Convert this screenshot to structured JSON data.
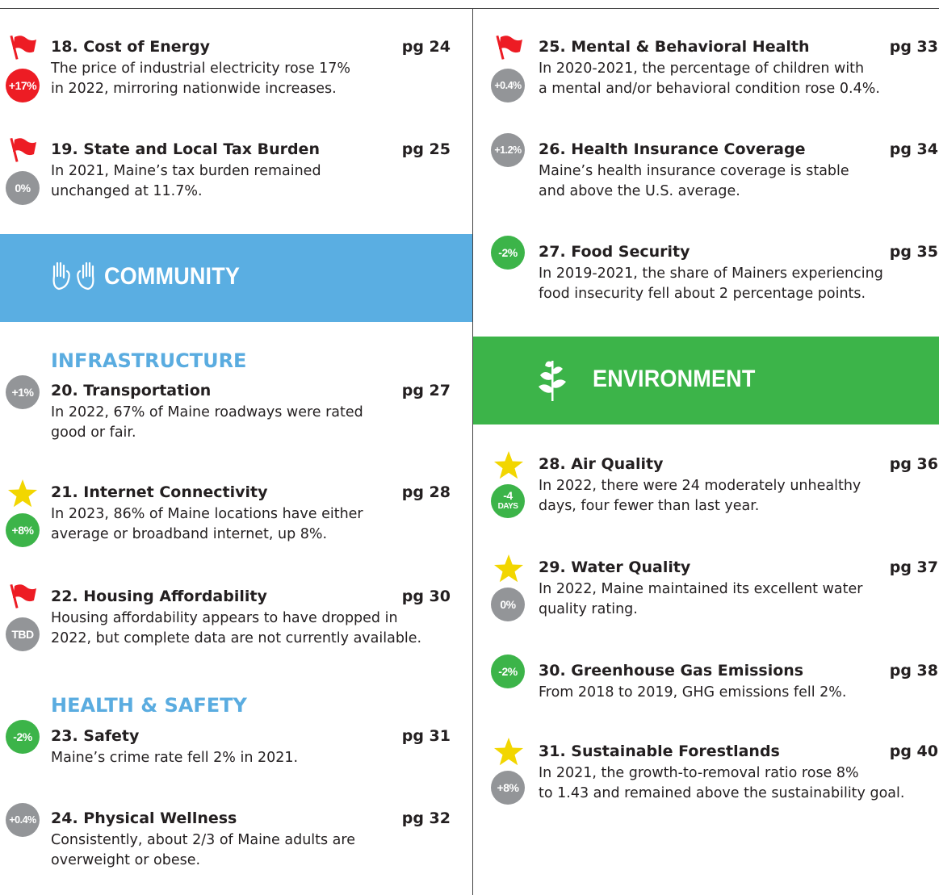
{
  "sections": {
    "community": {
      "title": "COMMUNITY",
      "icon": "hands-icon",
      "color": "#5aaee2"
    },
    "environment": {
      "title": "ENVIRONMENT",
      "icon": "plant-icon",
      "color": "#3cb449"
    },
    "infrastructure": "INFRASTRUCTURE",
    "health_safety": "HEALTH & SAFETY"
  },
  "items": {
    "i18": {
      "title": "18. Cost of Energy",
      "page": "pg 24",
      "badge": "+17%",
      "badge_color": "red",
      "marker": "red-flag",
      "desc": [
        "The price of industrial electricity rose 17%",
        "in 2022, mirroring nationwide increases."
      ]
    },
    "i19": {
      "title": "19. State and Local Tax Burden",
      "page": "pg 25",
      "badge": "0%",
      "badge_color": "gray",
      "marker": "red-flag",
      "desc": [
        "In 2021, Maine’s tax burden remained",
        "unchanged at 11.7%."
      ]
    },
    "i20": {
      "title": "20. Transportation",
      "page": "pg 27",
      "badge": "+1%",
      "badge_color": "gray",
      "desc": [
        "In 2022, 67% of Maine roadways were rated",
        "good or fair."
      ]
    },
    "i21": {
      "title": "21. Internet Connectivity",
      "page": "pg 28",
      "badge": "+8%",
      "badge_color": "green",
      "marker": "gold-star",
      "desc": [
        "In 2023, 86% of Maine locations have either",
        "average or broadband internet, up 8%."
      ]
    },
    "i22": {
      "title": "22. Housing Affordability",
      "page": "pg 30",
      "badge": "TBD",
      "badge_color": "gray",
      "marker": "red-flag",
      "desc": [
        "Housing affordability appears to have dropped in",
        "2022, but complete data are not currently available."
      ]
    },
    "i23": {
      "title": "23. Safety",
      "page": "pg 31",
      "badge": "-2%",
      "badge_color": "green",
      "desc": [
        "Maine’s crime rate fell 2% in 2021."
      ]
    },
    "i24": {
      "title": "24. Physical Wellness",
      "page": "pg 32",
      "badge": "+0.4%",
      "badge_color": "gray",
      "desc": [
        "Consistently, about 2/3 of Maine adults are",
        "overweight or obese."
      ]
    },
    "i25": {
      "title": "25. Mental & Behavioral Health",
      "page": "pg 33",
      "badge": "+0.4%",
      "badge_color": "gray",
      "marker": "red-flag",
      "desc": [
        "In 2020-2021, the percentage of children with",
        "a mental and/or behavioral condition rose 0.4%."
      ]
    },
    "i26": {
      "title": "26. Health Insurance Coverage",
      "page": "pg 34",
      "badge": "+1.2%",
      "badge_color": "gray",
      "desc": [
        "Maine’s health insurance coverage is stable",
        "and above the U.S. average."
      ]
    },
    "i27": {
      "title": "27. Food Security",
      "page": "pg 35",
      "badge": "-2%",
      "badge_color": "green",
      "desc": [
        "In 2019-2021, the share of Mainers experiencing",
        "food insecurity fell about 2 percentage points."
      ]
    },
    "i28": {
      "title": "28. Air Quality",
      "page": "pg 36",
      "badge": "-4",
      "badge_sub": "DAYS",
      "badge_color": "green",
      "marker": "gold-star",
      "desc": [
        "In 2022, there were 24 moderately unhealthy",
        "days, four fewer than last year."
      ]
    },
    "i29": {
      "title": "29. Water Quality",
      "page": "pg 37",
      "badge": "0%",
      "badge_color": "gray",
      "marker": "gold-star",
      "desc": [
        "In 2022, Maine maintained its excellent water",
        "quality rating."
      ]
    },
    "i30": {
      "title": "30. Greenhouse Gas Emissions",
      "page": "pg 38",
      "badge": "-2%",
      "badge_color": "green",
      "desc": [
        "From 2018 to 2019, GHG emissions fell 2%."
      ]
    },
    "i31": {
      "title": "31. Sustainable Forestlands",
      "page": "pg 40",
      "badge": "+8%",
      "badge_color": "gray",
      "marker": "gold-star",
      "desc": [
        "In 2021, the growth-to-removal ratio rose 8%",
        "to 1.43 and remained above the sustainability goal."
      ]
    }
  }
}
